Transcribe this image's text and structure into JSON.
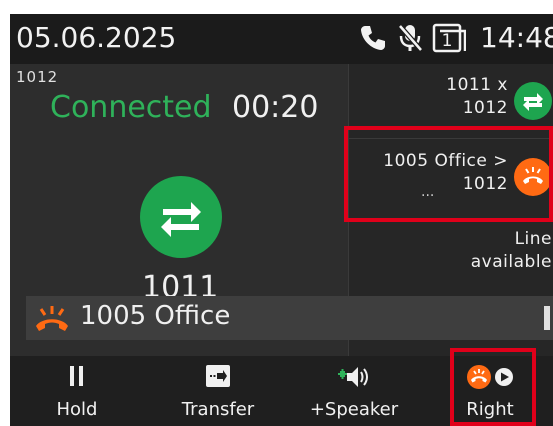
{
  "statusbar": {
    "date": "05.06.2025",
    "time": "14:48",
    "icons": [
      "phone-icon",
      "mic-muted-icon",
      "line-1-icon"
    ],
    "line_badge": "1"
  },
  "call": {
    "local_line": "1012",
    "state": "Connected",
    "timer": "00:20",
    "remote_number": "1011",
    "state_color": "#2fb25a"
  },
  "lines": [
    {
      "line1": "1011 x",
      "line2": "1012",
      "status": "connected",
      "color": "#1ea54f",
      "icon": "transfer-arrows-icon"
    },
    {
      "line1": "1005 Office >",
      "line2": "1012",
      "extra": "...",
      "status": "ringing",
      "color": "#ff6a13",
      "icon": "ringing-phone-icon"
    },
    {
      "line1": "Line",
      "line2": "available"
    }
  ],
  "notification": {
    "caller": "1005 Office",
    "icon": "ringing-phone-icon",
    "color": "#ff6a13"
  },
  "softkeys": [
    {
      "label": "Hold",
      "icon": "pause-icon"
    },
    {
      "label": "Transfer",
      "icon": "transfer-icon"
    },
    {
      "label": "+Speaker",
      "icon": "speaker-plus-icon"
    },
    {
      "label": "Right",
      "icon": "ringing-phone-play-icon"
    }
  ]
}
